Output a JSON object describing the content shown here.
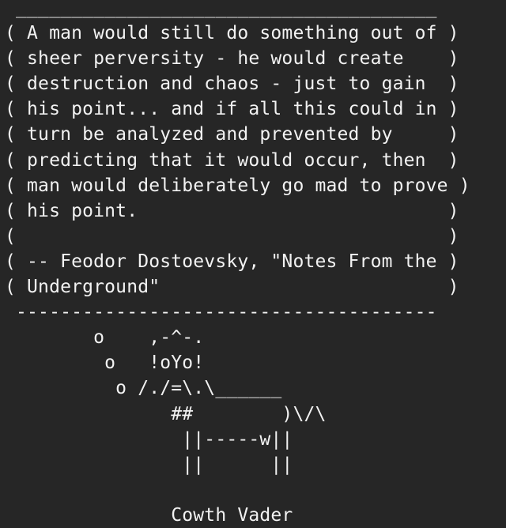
{
  "terminal": {
    "lines": [
      " ______________________________________",
      "( A man would still do something out of )",
      "( sheer perversity - he would create    )",
      "( destruction and chaos - just to gain  )",
      "( his point... and if all this could in )",
      "( turn be analyzed and prevented by     )",
      "( predicting that it would occur, then  )",
      "( man would deliberately go mad to prove )",
      "( his point.                            )",
      "(                                       )",
      "( -- Feodor Dostoevsky, \"Notes From the )",
      "( Underground\"                          )",
      " --------------------------------------",
      "        o    ,-^-.",
      "         o   !oYo!",
      "          o /./=\\.\\______",
      "               ##        )\\/\\",
      "                ||-----w||",
      "                ||      ||",
      "",
      "               Cowth Vader"
    ]
  },
  "colors": {
    "background": "#262626",
    "text": "#f2f2f2"
  }
}
